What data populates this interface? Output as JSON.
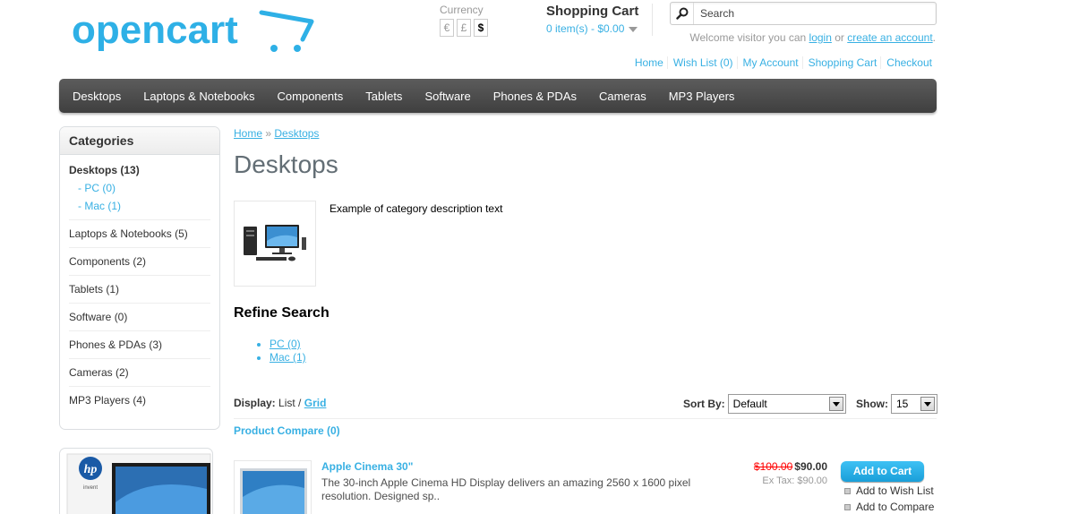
{
  "header": {
    "logo_text": "opencart",
    "currency": {
      "label": "Currency",
      "options": [
        "€",
        "£",
        "$"
      ],
      "active": "$"
    },
    "cart": {
      "heading": "Shopping Cart",
      "total": "0 item(s) - $0.00"
    },
    "search": {
      "placeholder": "Search"
    },
    "welcome": {
      "prefix": "Welcome visitor you can ",
      "login": "login",
      "middle": " or ",
      "register": "create an account",
      "suffix": "."
    },
    "links": [
      "Home",
      "Wish List (0)",
      "My Account",
      "Shopping Cart",
      "Checkout"
    ]
  },
  "menu": [
    "Desktops",
    "Laptops & Notebooks",
    "Components",
    "Tablets",
    "Software",
    "Phones & PDAs",
    "Cameras",
    "MP3 Players"
  ],
  "sidebar": {
    "heading": "Categories",
    "items": [
      {
        "label": "Desktops (13)",
        "active": true,
        "children": [
          "- PC (0)",
          "- Mac (1)"
        ]
      },
      {
        "label": "Laptops & Notebooks (5)"
      },
      {
        "label": "Components (2)"
      },
      {
        "label": "Tablets (1)"
      },
      {
        "label": "Software (0)"
      },
      {
        "label": "Phones & PDAs (3)"
      },
      {
        "label": "Cameras (2)"
      },
      {
        "label": "MP3 Players (4)"
      }
    ],
    "banner": {
      "logo": "hp",
      "tagline": "invent"
    }
  },
  "content": {
    "breadcrumb": [
      "Home",
      "Desktops"
    ],
    "breadcrumb_sep": "»",
    "title": "Desktops",
    "description": "Example of category description text",
    "refine": {
      "title": "Refine Search",
      "items": [
        "PC (0)",
        "Mac (1)"
      ]
    },
    "display": {
      "label": "Display:",
      "list": "List",
      "sep": " / ",
      "grid": "Grid"
    },
    "sort": {
      "label": "Sort By:",
      "value": "Default"
    },
    "show": {
      "label": "Show:",
      "value": "15"
    },
    "compare": "Product Compare (0)"
  },
  "product": {
    "name": "Apple Cinema 30\"",
    "description": "The 30-inch Apple Cinema HD Display delivers an amazing 2560 x 1600 pixel resolution. Designed sp..",
    "price_old": "$100.00",
    "price_new": "$90.00",
    "ex_tax": "Ex Tax: $90.00",
    "add_to_cart": "Add to Cart",
    "add_to_wishlist": "Add to Wish List",
    "add_to_compare": "Add to Compare"
  },
  "colors": {
    "accent": "#38b0e3",
    "menu_bg": "#4d4d4d",
    "title": "#636e75",
    "old_price": "#ff0000"
  }
}
